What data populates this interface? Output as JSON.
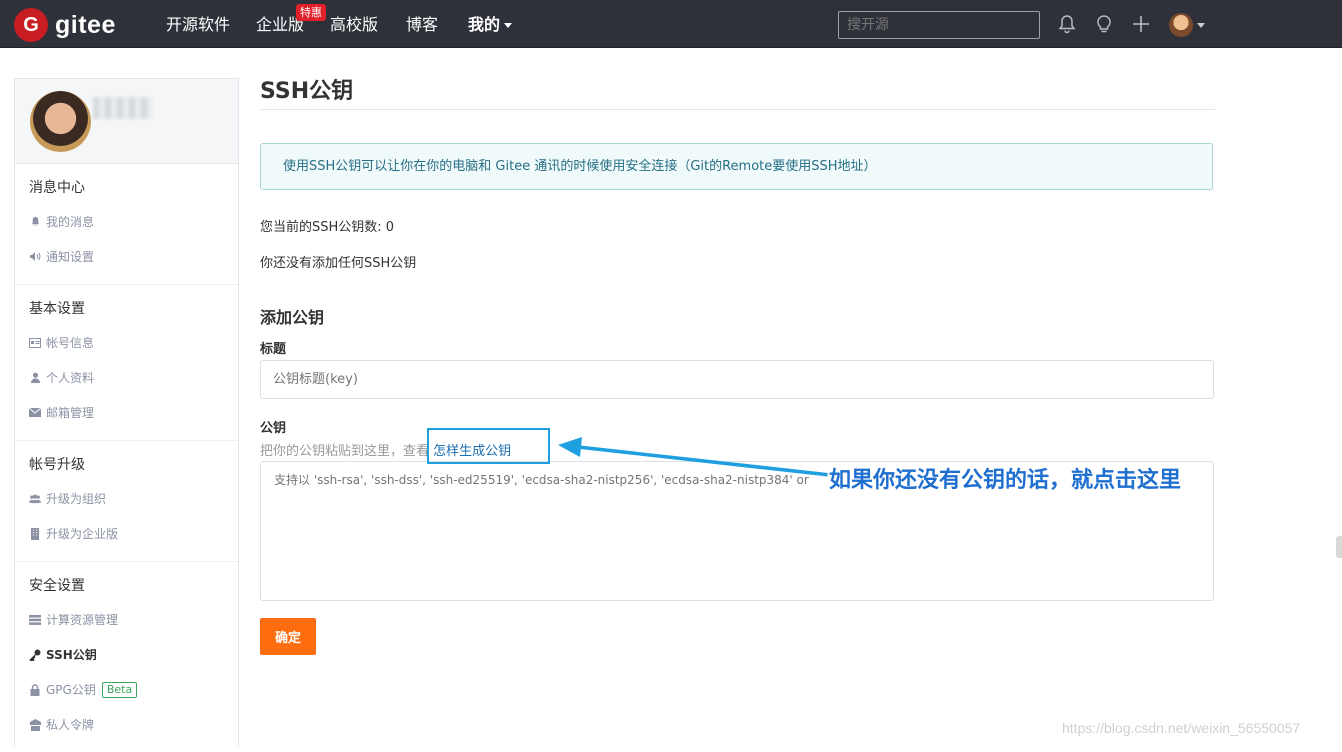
{
  "nav": {
    "logo_letter": "G",
    "logo_text": "gitee",
    "items": [
      {
        "label": "开源软件"
      },
      {
        "label": "企业版"
      },
      {
        "label": "高校版"
      },
      {
        "label": "博客"
      },
      {
        "label": "我的"
      }
    ],
    "badge": "特惠",
    "search_placeholder": "搜开源"
  },
  "sidebar": {
    "groups": [
      {
        "title": "消息中心",
        "items": [
          {
            "label": "我的消息",
            "icon": "bell-icon"
          },
          {
            "label": "通知设置",
            "icon": "speaker-icon"
          }
        ]
      },
      {
        "title": "基本设置",
        "items": [
          {
            "label": "帐号信息",
            "icon": "id-card-icon"
          },
          {
            "label": "个人资料",
            "icon": "user-icon"
          },
          {
            "label": "邮箱管理",
            "icon": "envelope-icon"
          }
        ]
      },
      {
        "title": "帐号升级",
        "items": [
          {
            "label": "升级为组织",
            "icon": "users-icon"
          },
          {
            "label": "升级为企业版",
            "icon": "building-icon"
          }
        ]
      },
      {
        "title": "安全设置",
        "items": [
          {
            "label": "计算资源管理",
            "icon": "server-icon"
          },
          {
            "label": "SSH公钥",
            "icon": "key-icon"
          },
          {
            "label": "GPG公钥",
            "icon": "lock-icon",
            "badge": "Beta"
          },
          {
            "label": "私人令牌",
            "icon": "token-icon"
          }
        ]
      }
    ]
  },
  "main": {
    "title": "SSH公钥",
    "alert": "使用SSH公钥可以让你在你的电脑和 Gitee 通讯的时候使用安全连接（Git的Remote要使用SSH地址）",
    "count_text": "您当前的SSH公钥数: 0",
    "none_text": "你还没有添加任何SSH公钥",
    "add_title": "添加公钥",
    "label_title": "标题",
    "title_placeholder": "公钥标题(key)",
    "label_key": "公钥",
    "key_hint_prefix": "把你的公钥粘贴到这里，查看 ",
    "key_hint_link": "怎样生成公钥",
    "key_placeholder": "支持以 'ssh-rsa', 'ssh-dss', 'ssh-ed25519', 'ecdsa-sha2-nistp256', 'ecdsa-sha2-nistp384' or",
    "confirm_label": "确定"
  },
  "annotation": {
    "text": "如果你还没有公钥的话，就点击这里",
    "color": "#1f9fe0"
  },
  "watermark": "https://blog.csdn.net/weixin_56550057",
  "colors": {
    "navbar": "#2e3139",
    "logo_red": "#c71d23",
    "confirm_orange": "#fd6d10",
    "link_blue": "#1a6eb3"
  }
}
